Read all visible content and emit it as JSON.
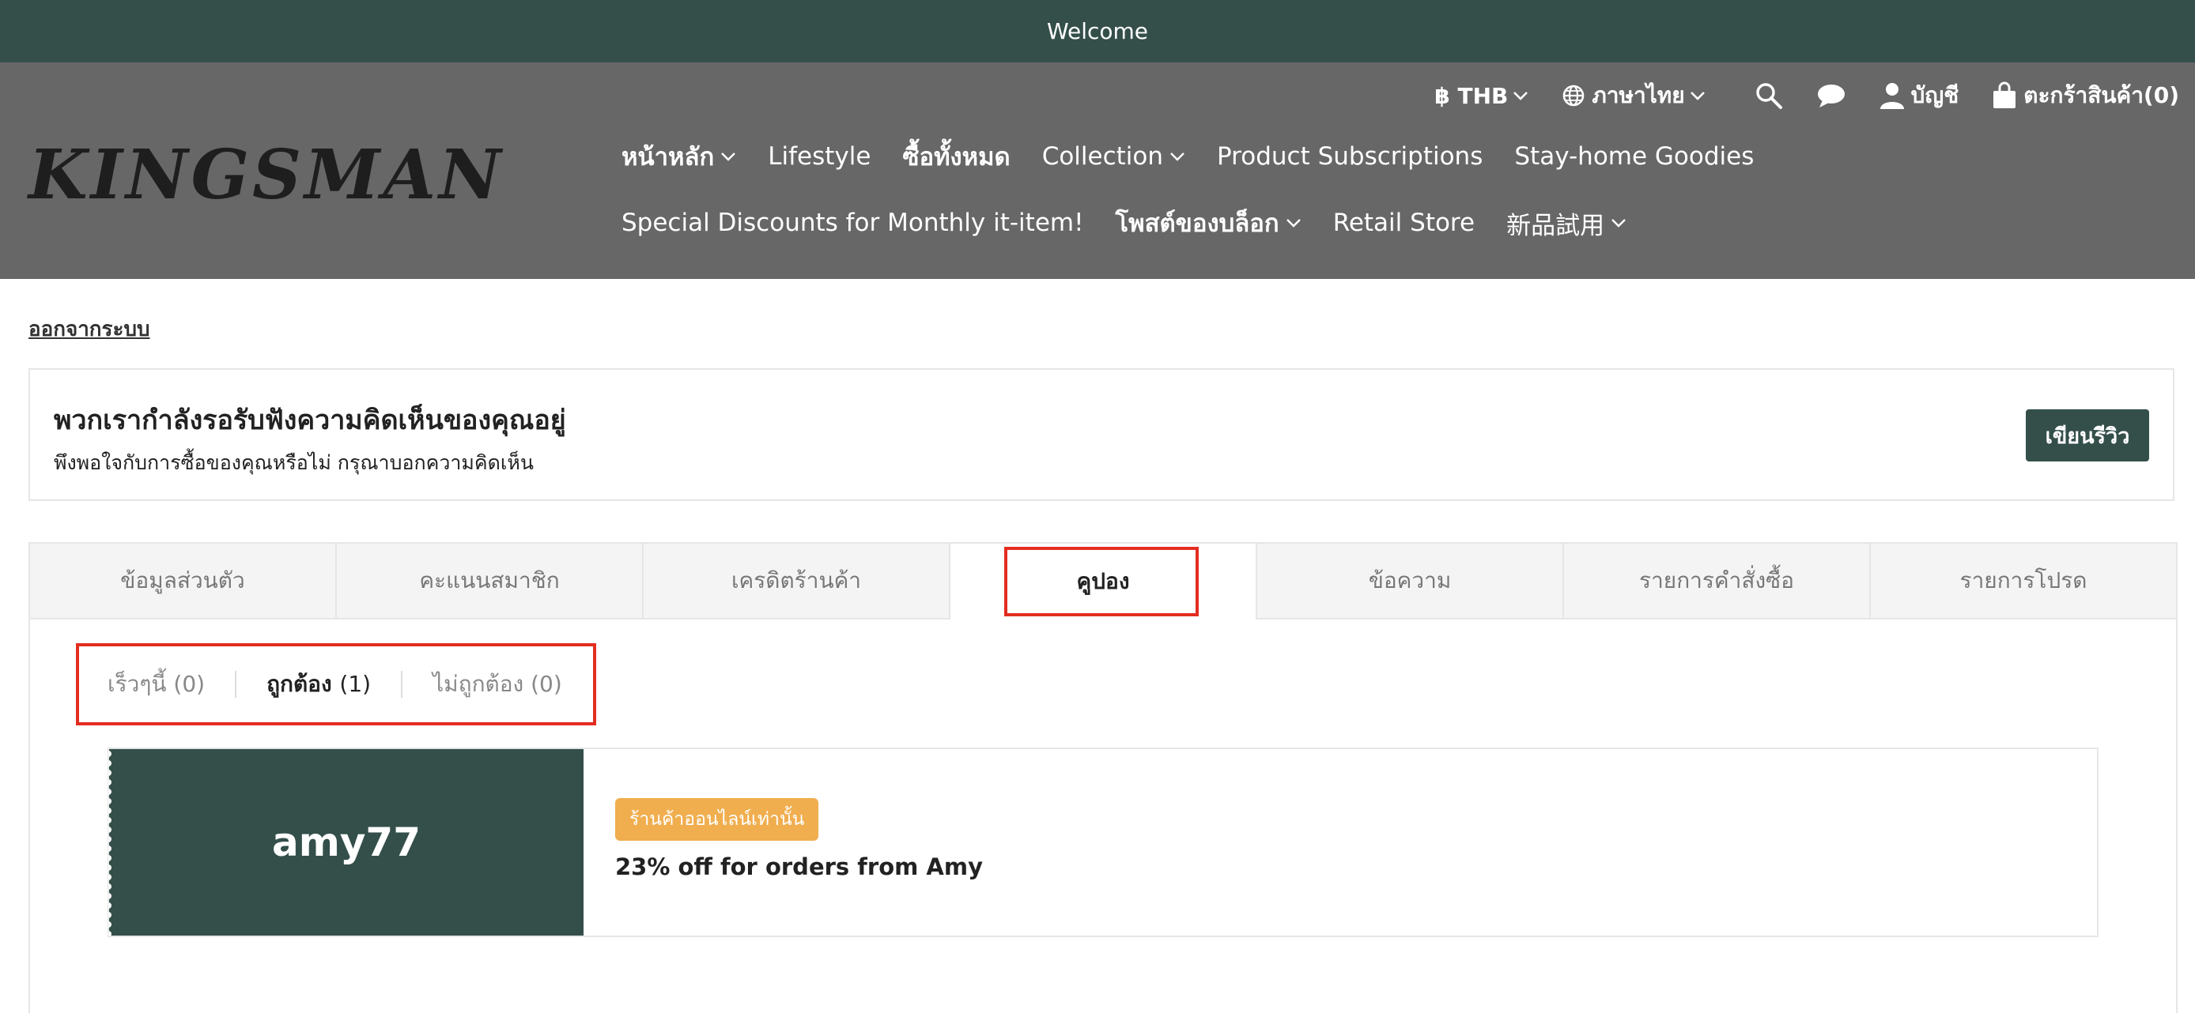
{
  "topbar": {
    "text": "Welcome"
  },
  "header": {
    "logo": "KINGSMAN",
    "utility": {
      "currency": "฿ THB",
      "language": "ภาษาไทย",
      "account": "บัญชี",
      "cart": "ตะกร้าสินค้า(0)"
    },
    "nav_row1": [
      {
        "label": "หน้าหลัก",
        "dropdown": true,
        "bold": true
      },
      {
        "label": "Lifestyle",
        "dropdown": false,
        "bold": false
      },
      {
        "label": "ซื้อทั้งหมด",
        "dropdown": false,
        "bold": true
      },
      {
        "label": "Collection",
        "dropdown": true,
        "bold": false
      },
      {
        "label": "Product Subscriptions",
        "dropdown": false,
        "bold": false
      },
      {
        "label": "Stay-home Goodies",
        "dropdown": false,
        "bold": false
      }
    ],
    "nav_row2": [
      {
        "label": "Special Discounts for Monthly it-item!",
        "dropdown": false,
        "bold": false
      },
      {
        "label": "โพสต์ของบล็อก",
        "dropdown": true,
        "bold": true
      },
      {
        "label": "Retail Store",
        "dropdown": false,
        "bold": false
      },
      {
        "label": "新品試用",
        "dropdown": true,
        "bold": false
      }
    ]
  },
  "logout": "ออกจากระบบ",
  "review": {
    "title": "พวกเรากำลังรอรับฟังความคิดเห็นของคุณอยู่",
    "subtitle": "พึงพอใจกับการซื้อของคุณหรือไม่ กรุณาบอกความคิดเห็น",
    "button": "เขียนรีวิว"
  },
  "tabs": [
    {
      "label": "ข้อมูลส่วนตัว",
      "active": false
    },
    {
      "label": "คะแนนสมาชิก",
      "active": false
    },
    {
      "label": "เครดิตร้านค้า",
      "active": false
    },
    {
      "label": "คูปอง",
      "active": true
    },
    {
      "label": "ข้อความ",
      "active": false
    },
    {
      "label": "รายการคำสั่งซื้อ",
      "active": false
    },
    {
      "label": "รายการโปรด",
      "active": false
    }
  ],
  "subtabs": [
    {
      "label": "เร็วๆนี้",
      "count": "(0)",
      "active": false
    },
    {
      "label": "ถูกต้อง",
      "count": "(1)",
      "active": true
    },
    {
      "label": "ไม่ถูกต้อง",
      "count": "(0)",
      "active": false
    }
  ],
  "coupon": {
    "code": "amy77",
    "badge": "ร้านค้าออนไลน์เท่านั้น",
    "description": "23% off for orders from Amy"
  },
  "colors": {
    "primary": "#344f4a",
    "header_bg": "#676767",
    "badge": "#f0ae4f",
    "highlight": "#e32d20"
  }
}
